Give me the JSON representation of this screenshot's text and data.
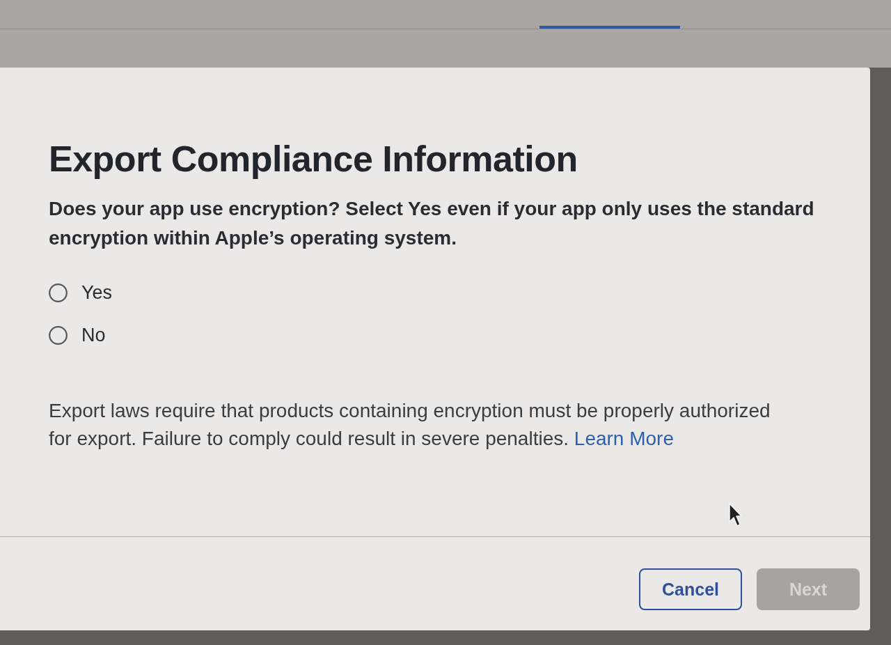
{
  "header": {
    "tabs": [
      {
        "selected": true
      }
    ]
  },
  "dialog": {
    "title": "Export Compliance Information",
    "question": "Does your app use encryption? Select Yes even if your app only uses the standard encryption within Apple’s operating system.",
    "options": [
      {
        "label": "Yes",
        "selected": false
      },
      {
        "label": "No",
        "selected": false
      }
    ],
    "notice": {
      "text": "Export laws require that products containing encryption must be properly authorized for export. Failure to comply could result in severe penalties.",
      "link": "Learn More"
    },
    "buttons": [
      {
        "label": "Cancel",
        "kind": "secondary",
        "disabled": false
      },
      {
        "label": "Next",
        "kind": "primary",
        "disabled": true
      }
    ]
  }
}
